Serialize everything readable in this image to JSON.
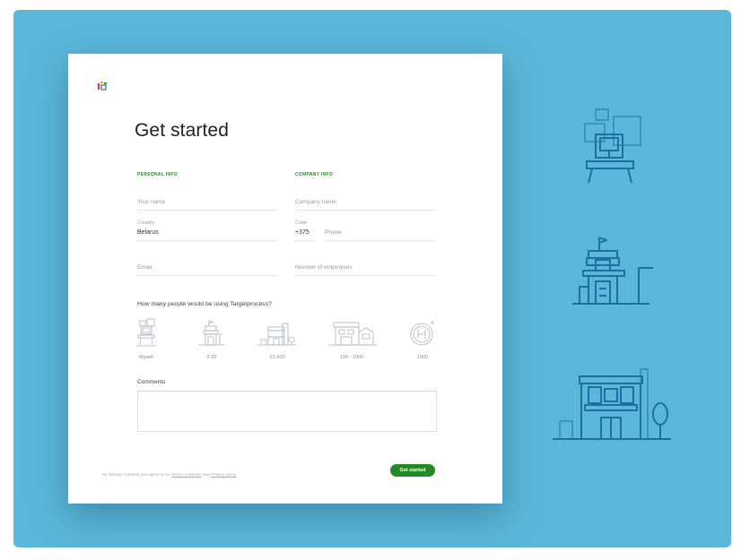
{
  "form": {
    "title": "Get started",
    "personal_header": "PERSONAL INFO",
    "company_header": "COMPANY INFO",
    "name_placeholder": "Your name",
    "company_placeholder": "Company name",
    "country_label": "Country",
    "country_value": "Belarus",
    "code_label": "Code",
    "code_value": "+375",
    "phone_placeholder": "Phone",
    "email_placeholder": "Email",
    "employees_placeholder": "Number of employees",
    "question": "How many people would be using Targetprocess?",
    "options": [
      "Myself",
      "2-20",
      "21-100",
      "100 - 1000",
      "1000"
    ],
    "comments_label": "Comments",
    "terms_prefix": "By clicking Continue you agree to our ",
    "terms_link": "Terms of service",
    "terms_and": " and ",
    "privacy_link": "Privacy policy",
    "submit_label": "Get started"
  },
  "icons": {
    "logo": "targetprocess-logo",
    "option_icons": [
      "desk-icon",
      "small-building-icon",
      "shop-building-icon",
      "large-building-icon",
      "hospital-icon"
    ],
    "illustrations": [
      "desk-illustration",
      "small-building-illustration",
      "office-building-illustration"
    ]
  },
  "colors": {
    "background": "#5bb7d9",
    "accent": "#258a25",
    "illustration_stroke": "#1e6fa2"
  }
}
